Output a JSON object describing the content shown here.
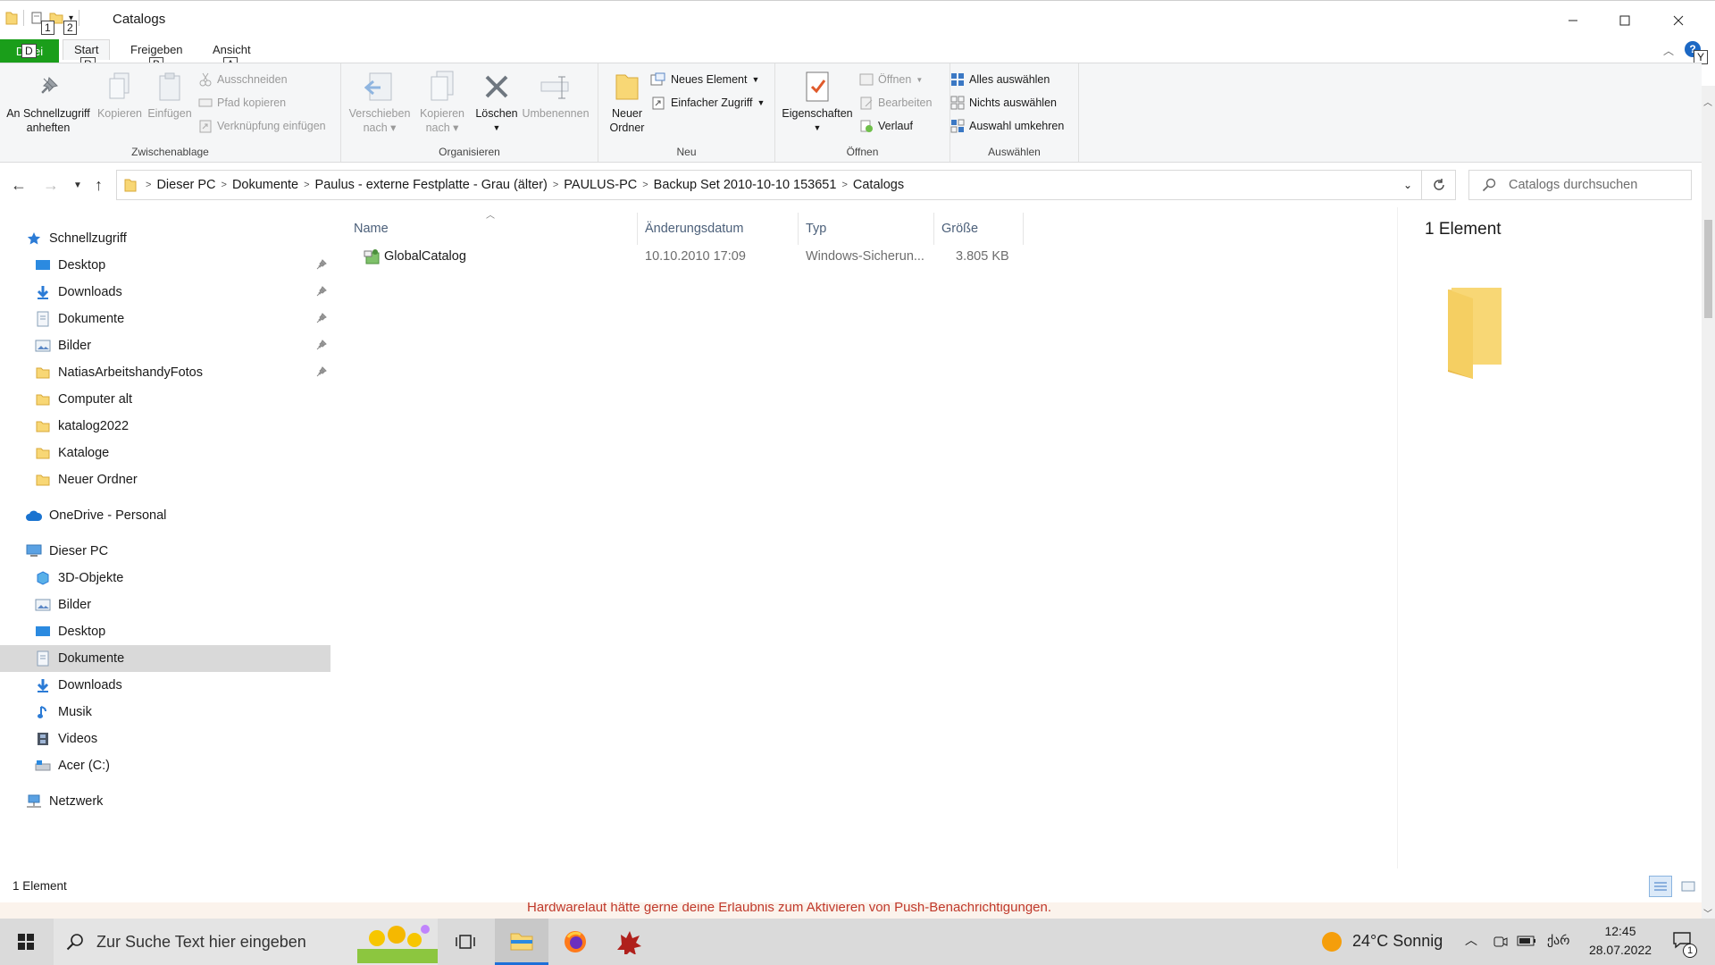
{
  "window": {
    "title": "Catalogs",
    "keytips": {
      "qat1": "1",
      "qat2": "2",
      "tab_file": "D",
      "tab_start": "R",
      "tab_share": "B",
      "tab_view": "A",
      "help": "Y"
    }
  },
  "ribbon_tabs": {
    "file": "Datei",
    "start": "Start",
    "share": "Freigeben",
    "view": "Ansicht"
  },
  "ribbon": {
    "clipboard": {
      "label": "Zwischenablage",
      "pin_line1": "An Schnellzugriff",
      "pin_line2": "anheften",
      "copy": "Kopieren",
      "paste": "Einfügen",
      "cut": "Ausschneiden",
      "copy_path": "Pfad kopieren",
      "paste_shortcut": "Verknüpfung einfügen"
    },
    "organize": {
      "label": "Organisieren",
      "move_line1": "Verschieben",
      "move_line2": "nach",
      "copyto_line1": "Kopieren",
      "copyto_line2": "nach",
      "delete": "Löschen",
      "rename": "Umbenennen"
    },
    "new": {
      "label": "Neu",
      "new_folder_line1": "Neuer",
      "new_folder_line2": "Ordner",
      "new_item": "Neues Element",
      "easy_access": "Einfacher Zugriff"
    },
    "open": {
      "label": "Öffnen",
      "properties": "Eigenschaften",
      "open": "Öffnen",
      "edit": "Bearbeiten",
      "history": "Verlauf"
    },
    "select": {
      "label": "Auswählen",
      "select_all": "Alles auswählen",
      "select_none": "Nichts auswählen",
      "invert": "Auswahl umkehren"
    }
  },
  "address": {
    "crumbs": [
      "Dieser PC",
      "Dokumente",
      "Paulus - externe Festplatte - Grau (älter)",
      "PAULUS-PC",
      "Backup Set 2010-10-10 153651",
      "Catalogs"
    ]
  },
  "search": {
    "placeholder": "Catalogs durchsuchen"
  },
  "nav": {
    "quick_access": "Schnellzugriff",
    "quick_items": [
      "Desktop",
      "Downloads",
      "Dokumente",
      "Bilder",
      "NatiasArbeitshandyFotos",
      "Computer alt",
      "katalog2022",
      "Kataloge",
      "Neuer Ordner"
    ],
    "onedrive": "OneDrive - Personal",
    "this_pc": "Dieser PC",
    "pc_items": [
      "3D-Objekte",
      "Bilder",
      "Desktop",
      "Dokumente",
      "Downloads",
      "Musik",
      "Videos",
      "Acer (C:)"
    ],
    "network": "Netzwerk"
  },
  "columns": {
    "name": "Name",
    "date": "Änderungsdatum",
    "type": "Typ",
    "size": "Größe"
  },
  "files": [
    {
      "name": "GlobalCatalog",
      "date": "10.10.2010 17:09",
      "type": "Windows-Sicherun...",
      "size": "3.805 KB"
    }
  ],
  "details": {
    "count": "1 Element"
  },
  "status": {
    "count": "1 Element"
  },
  "behind_window_text": "Hardwarelaut hätte gerne deine Erlaubnis zum Aktivieren von Push-Benachrichtigungen.",
  "taskbar": {
    "search_placeholder": "Zur Suche Text hier eingeben",
    "weather": "24°C  Sonnig",
    "lang": "ქარ",
    "time": "12:45",
    "date": "28.07.2022",
    "notifications": "1"
  },
  "colors": {
    "accent": "#1a9e1a",
    "selection": "#d9d9d9",
    "folder": "#f8d775",
    "taskbar": "#dadada"
  }
}
